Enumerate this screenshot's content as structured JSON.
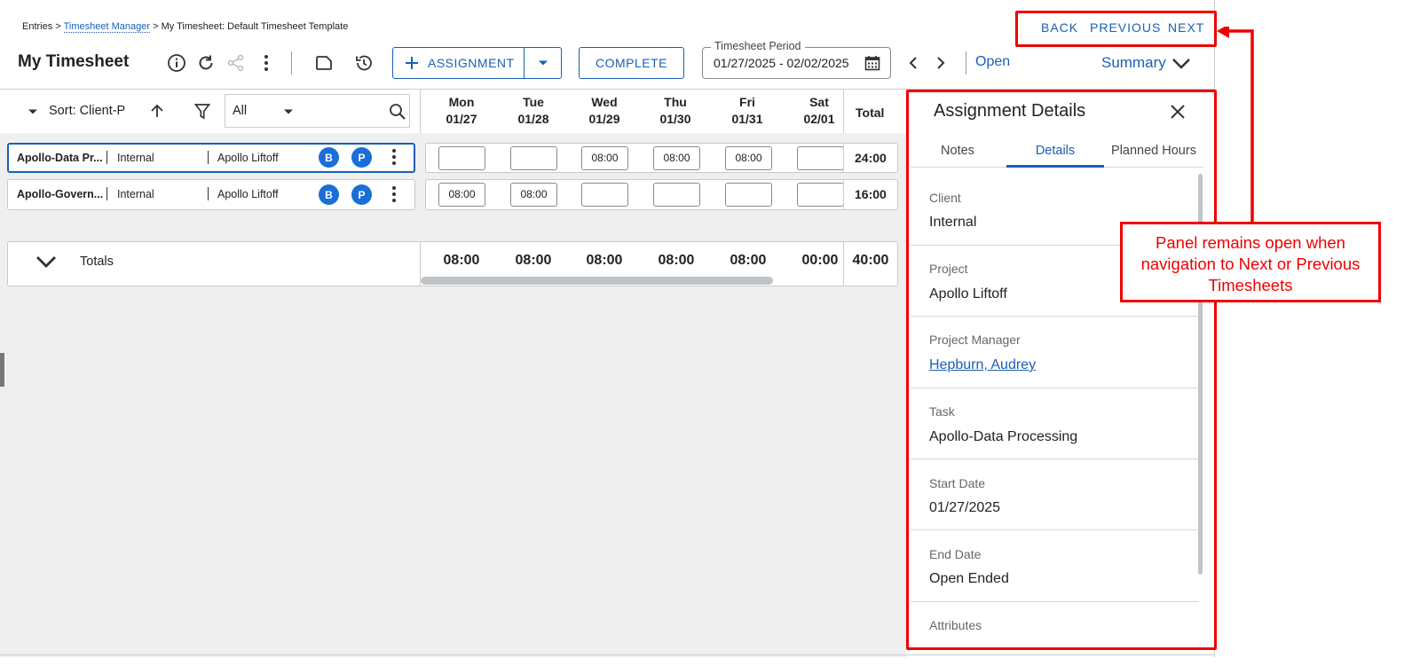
{
  "breadcrumb": {
    "entries": "Entries",
    "sep1": ">",
    "timesheet_manager": "Timesheet Manager",
    "sep2": ">",
    "current": "My Timesheet: Default Timesheet Template"
  },
  "page_title": "My Timesheet",
  "toolbar": {
    "assignment_label": "ASSIGNMENT",
    "complete_label": "COMPLETE",
    "period_legend": "Timesheet Period",
    "period_value": "01/27/2025 - 02/02/2025",
    "open_label": "Open",
    "summary_label": "Summary"
  },
  "nav": {
    "back": "BACK",
    "previous": "PREVIOUS",
    "next": "NEXT"
  },
  "sortbar": {
    "sort_label": "Sort: Client-P",
    "filter_value": "All"
  },
  "days": [
    {
      "name": "Mon",
      "date": "01/27"
    },
    {
      "name": "Tue",
      "date": "01/28"
    },
    {
      "name": "Wed",
      "date": "01/29"
    },
    {
      "name": "Thu",
      "date": "01/30"
    },
    {
      "name": "Fri",
      "date": "01/31"
    },
    {
      "name": "Sat",
      "date": "02/01"
    }
  ],
  "total_header": "Total",
  "rows": [
    {
      "assignment": "Apollo-Data Pr...",
      "client": "Internal",
      "project": "Apollo Liftoff",
      "badge1": "B",
      "badge2": "P",
      "hours": [
        "",
        "",
        "08:00",
        "08:00",
        "08:00",
        ""
      ],
      "total": "24:00"
    },
    {
      "assignment": "Apollo-Govern...",
      "client": "Internal",
      "project": "Apollo Liftoff",
      "badge1": "B",
      "badge2": "P",
      "hours": [
        "08:00",
        "08:00",
        "",
        "",
        "",
        ""
      ],
      "total": "16:00"
    }
  ],
  "totals": {
    "label": "Totals",
    "values": [
      "08:00",
      "08:00",
      "08:00",
      "08:00",
      "08:00",
      "00:00"
    ],
    "grand_total": "40:00"
  },
  "panel": {
    "title": "Assignment Details",
    "tabs": [
      "Notes",
      "Details",
      "Planned Hours"
    ],
    "fields": [
      {
        "label": "Client",
        "value": "Internal"
      },
      {
        "label": "Project",
        "value": "Apollo Liftoff"
      },
      {
        "label": "Project Manager",
        "value": "Hepburn, Audrey"
      },
      {
        "label": "Task",
        "value": "Apollo-Data Processing"
      },
      {
        "label": "Start Date",
        "value": "01/27/2025"
      },
      {
        "label": "End Date",
        "value": "Open Ended"
      },
      {
        "label": "Attributes",
        "value": ""
      }
    ]
  },
  "annotation": {
    "callout_text": "Panel remains open when navigation to Next or Previous Timesheets",
    "color": "#e00000"
  },
  "colors": {
    "accent": "#1a5fb4",
    "badge": "#1a6ed8"
  }
}
